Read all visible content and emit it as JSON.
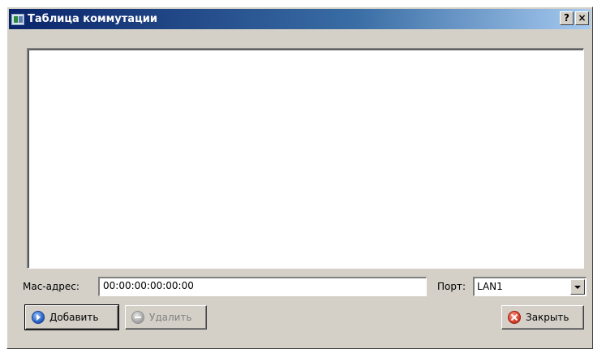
{
  "window": {
    "title": "Таблица коммутации",
    "help_label": "?",
    "close_label": "×"
  },
  "table": {
    "rows": []
  },
  "form": {
    "mac_label": "Mac-адрес:",
    "mac_value": "00:00:00:00:00:00",
    "port_label": "Порт:",
    "port_selected": "LAN1"
  },
  "buttons": {
    "add_label": "Добавить",
    "delete_label": "Удалить",
    "close_label": "Закрыть"
  },
  "icons": {
    "app": "network-table-icon",
    "add": "add-arrow-icon",
    "delete": "remove-icon",
    "close": "close-circle-icon"
  },
  "colors": {
    "titlebar_start": "#0a246a",
    "titlebar_end": "#a6caf0",
    "window_bg": "#d4d0c8"
  }
}
